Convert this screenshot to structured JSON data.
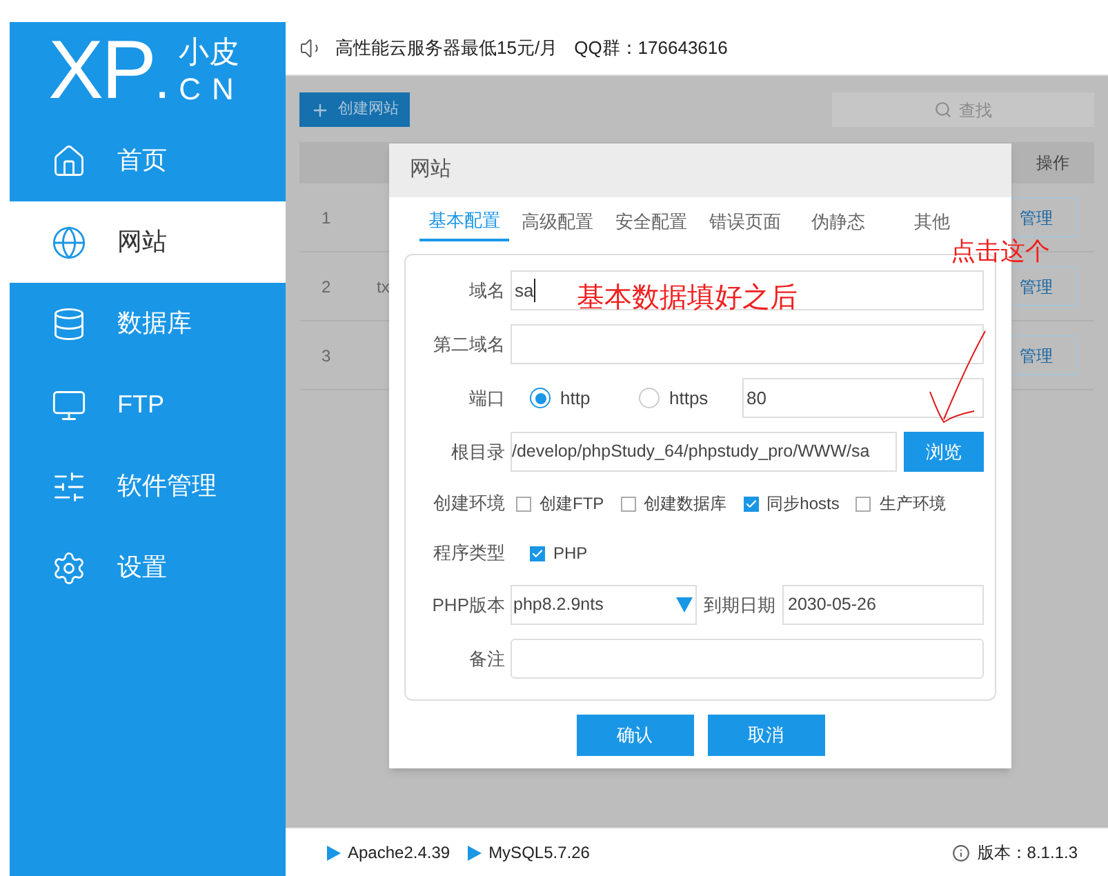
{
  "logo": {
    "mark": "XP",
    "dot": ".",
    "sub_top": "小皮",
    "sub_bottom": "CN"
  },
  "sidebar": {
    "items": [
      {
        "label": "首页",
        "selected": false
      },
      {
        "label": "网站",
        "selected": true
      },
      {
        "label": "数据库",
        "selected": false
      },
      {
        "label": "FTP",
        "selected": false
      },
      {
        "label": "软件管理",
        "selected": false
      },
      {
        "label": "设置",
        "selected": false
      }
    ]
  },
  "notice": {
    "text": "高性能云服务器最低15元/月",
    "qq": "QQ群：176643616"
  },
  "toolbar": {
    "create_button": "创建网站",
    "search_placeholder": "查找"
  },
  "table": {
    "columns": [
      {
        "label": "操作"
      }
    ],
    "rows": [
      {
        "number": "1",
        "action": "管理"
      },
      {
        "number": "2",
        "column_2": "tx",
        "action": "管理"
      },
      {
        "number": "3",
        "action": "管理"
      }
    ]
  },
  "dialog": {
    "title": "网站",
    "tabs": [
      {
        "label": "基本配置",
        "selected": true
      },
      {
        "label": "高级配置",
        "selected": false
      },
      {
        "label": "安全配置",
        "selected": false
      },
      {
        "label": "错误页面",
        "selected": false
      },
      {
        "label": "伪静态",
        "selected": false
      },
      {
        "label": "其他",
        "selected": false
      }
    ],
    "domain": {
      "label": "域名",
      "value": "sa"
    },
    "second_domain": {
      "label": "第二域名"
    },
    "port": {
      "label": "端口",
      "options": [
        {
          "label": "http",
          "selected": true
        },
        {
          "label": "https",
          "selected": false
        }
      ],
      "value": "80"
    },
    "root": {
      "label": "根目录",
      "value": "/develop/phpStudy_64/phpstudy_pro/WWW/sa",
      "button": "浏览"
    },
    "environment": {
      "label": "创建环境",
      "options": [
        {
          "label": "创建FTP",
          "checked": false
        },
        {
          "label": "创建数据库",
          "checked": false
        },
        {
          "label": "同步hosts",
          "checked": true
        },
        {
          "label": "生产环境",
          "checked": false
        }
      ]
    },
    "program_type": {
      "label": "程序类型",
      "options": [
        {
          "label": "PHP",
          "checked": true
        }
      ]
    },
    "php_version": {
      "label": "PHP版本",
      "value": "php8.2.9nts",
      "expiry_label": "到期日期",
      "expiry_value": "2030-05-26"
    },
    "note": {
      "label": "备注"
    },
    "buttons": [
      "确认",
      "取消"
    ]
  },
  "annotations": [
    {
      "text": "基本数据填好之后"
    },
    {
      "text": "点击这个"
    }
  ],
  "footer": {
    "services": [
      {
        "label": "Apache2.4.39"
      },
      {
        "label": "MySQL5.7.26"
      }
    ],
    "version": "版本：8.1.1.3"
  }
}
